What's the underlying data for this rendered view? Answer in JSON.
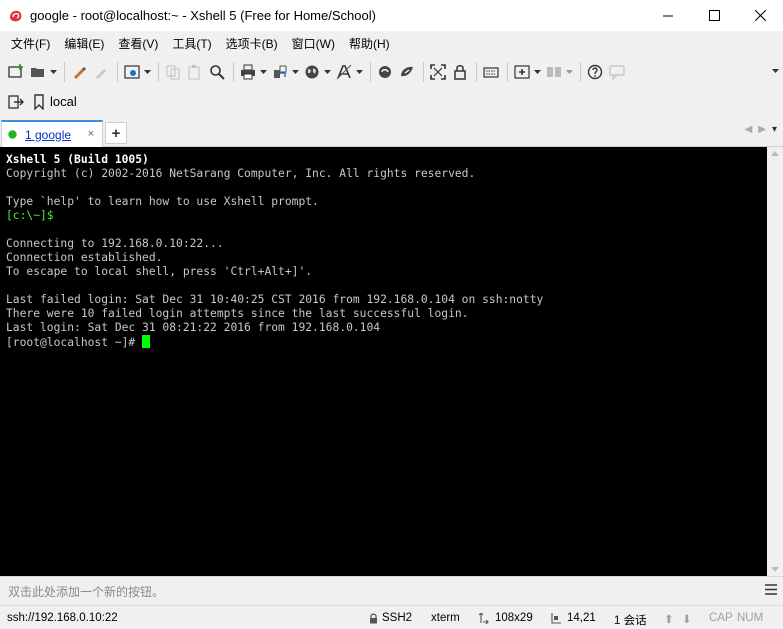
{
  "window": {
    "title": "google - root@localhost:~ - Xshell 5 (Free for Home/School)"
  },
  "menu": [
    "文件(F)",
    "编辑(E)",
    "查看(V)",
    "工具(T)",
    "选项卡(B)",
    "窗口(W)",
    "帮助(H)"
  ],
  "address": {
    "label": "local"
  },
  "tabs": [
    {
      "label": "1 google",
      "close": "×"
    }
  ],
  "tab_add": "+",
  "terminal": {
    "lines": [
      "Xshell 5 (Build 1005)",
      "Copyright (c) 2002-2016 NetSarang Computer, Inc. All rights reserved.",
      "",
      "Type `help' to learn how to use Xshell prompt.",
      "[c:\\~]$",
      "",
      "Connecting to 192.168.0.10:22...",
      "Connection established.",
      "To escape to local shell, press 'Ctrl+Alt+]'.",
      "",
      "Last failed login: Sat Dec 31 10:40:25 CST 2016 from 192.168.0.104 on ssh:notty",
      "There were 10 failed login attempts since the last successful login.",
      "Last login: Sat Dec 31 08:21:22 2016 from 192.168.0.104",
      "[root@localhost ~]# "
    ]
  },
  "quickbar": {
    "hint": "双击此处添加一个新的按钮。"
  },
  "status": {
    "connection": "ssh://192.168.0.10:22",
    "protocol": "SSH2",
    "term": "xterm",
    "size": "108x29",
    "position": "14,21",
    "sessions": "1 会话",
    "caps": "CAP",
    "num": "NUM"
  },
  "colors": {
    "terminal_bg": "#000000",
    "terminal_fg": "#c8c8c8",
    "cursor": "#00ff00",
    "prompt_green": "#4ee44e",
    "tab_accent": "#3b8fd8"
  }
}
